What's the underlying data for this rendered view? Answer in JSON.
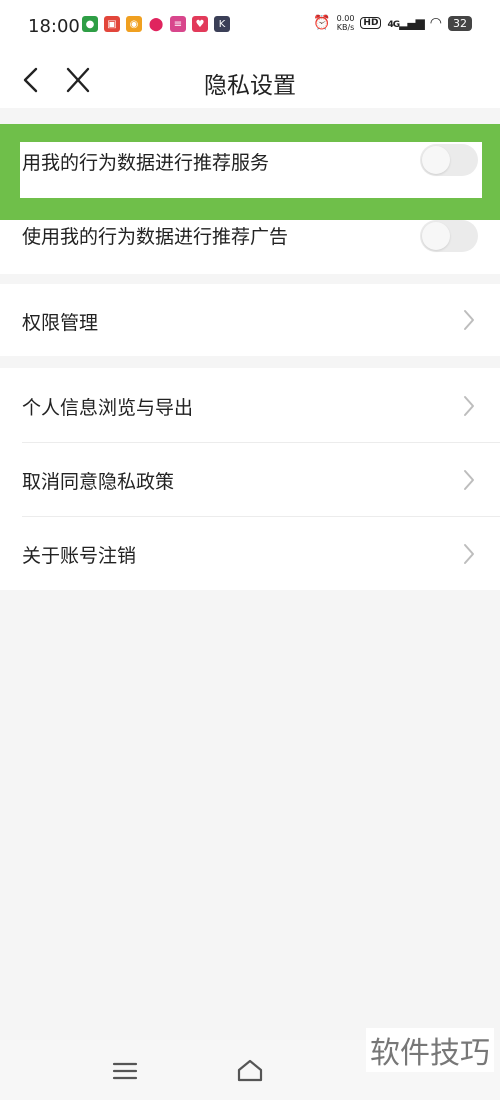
{
  "status_bar": {
    "time": "18:00",
    "net_speed_value": "0.00",
    "net_speed_unit": "KB/s",
    "hd_badge": "HD",
    "network": "4G",
    "battery": "32",
    "notification_icons": [
      "app-icon-green",
      "app-icon-red",
      "weibo-icon",
      "pin-icon",
      "app-icon-pink",
      "heart-app-icon",
      "k-app-icon"
    ]
  },
  "header": {
    "title": "隐私设置"
  },
  "settings": {
    "toggles": [
      {
        "label": "用我的行为数据进行推荐服务",
        "on": false
      },
      {
        "label": "使用我的行为数据进行推荐广告",
        "on": false
      }
    ],
    "permission": {
      "label": "权限管理"
    },
    "items": [
      {
        "label": "个人信息浏览与导出"
      },
      {
        "label": "取消同意隐私政策"
      },
      {
        "label": "关于账号注销"
      }
    ]
  },
  "watermark": "软件技巧",
  "colors": {
    "highlight": "#6fbf4a",
    "background": "#f5f5f5"
  }
}
